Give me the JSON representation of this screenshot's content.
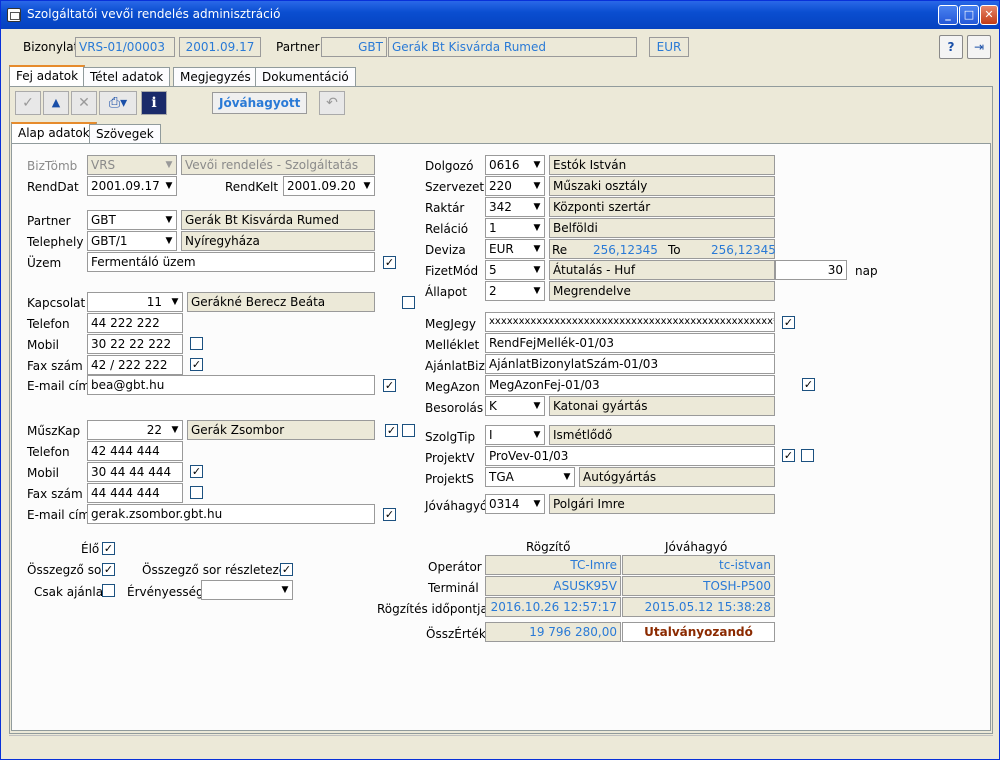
{
  "window": {
    "title": "Szolgáltatói vevői rendelés adminisztráció"
  },
  "header": {
    "bizonylat_label": "Bizonylat",
    "doc_no": "VRS-01/00003",
    "date": "2001.09.17",
    "partner_label": "Partner",
    "partner_code": "GBT",
    "partner_name": "Gerák Bt Kisvárda Rumed",
    "currency": "EUR"
  },
  "tabs": [
    "Fej adatok",
    "Tétel adatok",
    "Megjegyzés",
    "Dokumentáció"
  ],
  "toolbar": {
    "approved_label": "Jóváhagyott"
  },
  "subtabs": [
    "Alap adatok",
    "Szövegek"
  ],
  "left": {
    "biztomb_label": "BizTömb",
    "biztomb_value": "VRS",
    "biztomb_desc": "Vevői rendelés - Szolgáltatás",
    "renddat_label": "RendDat",
    "renddat_value": "2001.09.17",
    "rendkelt_label": "RendKelt",
    "rendkelt_value": "2001.09.20",
    "partner_label": "Partner",
    "partner_code": "GBT",
    "partner_name": "Gerák Bt Kisvárda Rumed",
    "telephely_label": "Telephely",
    "telephely_code": "GBT/1",
    "telephely_name": "Nyíregyháza",
    "uzem_label": "Üzem",
    "uzem_value": "Fermentáló üzem",
    "kapcsolat_label": "Kapcsolat",
    "kapcsolat_no": "11",
    "kapcsolat_name": "Gerákné Berecz Beáta",
    "telefon_label": "Telefon",
    "telefon1": "44 222 222",
    "mobil_label": "Mobil",
    "mobil1": "30 22 22 222",
    "fax_label": "Fax szám",
    "fax1": "42 / 222 222",
    "email_label": "E-mail cím",
    "email1": "bea@gbt.hu",
    "muszkap_label": "MűszKap",
    "muszkap_no": "22",
    "muszkap_name": "Gerák Zsombor",
    "telefon2": "42 444 444",
    "mobil2": "30 44 44 444",
    "fax2": "44 444 444",
    "email2": "gerak.zsombor.gbt.hu",
    "elo_label": "Élő",
    "osszegzo_label": "Összegző sor",
    "osszegzo_resz_label": "Összegző sor részletezés",
    "csak_label": "Csak ajánlat",
    "ervenyesseg_label": "Érvényesség"
  },
  "right": {
    "dolgozo_label": "Dolgozó",
    "dolgozo_code": "0616",
    "dolgozo_name": "Estók István",
    "szervezet_label": "Szervezet",
    "szervezet_code": "220",
    "szervezet_name": "Műszaki osztály",
    "raktar_label": "Raktár",
    "raktar_code": "342",
    "raktar_name": "Központi szertár",
    "relacio_label": "Reláció",
    "relacio_code": "1",
    "relacio_name": "Belföldi",
    "deviza_label": "Deviza",
    "deviza_code": "EUR",
    "re_label": "Re",
    "re_value": "256,12345",
    "to_label": "To",
    "to_value": "256,12345",
    "fizetmod_label": "FizetMód",
    "fizetmod_code": "5",
    "fizetmod_name": "Átutalás - Huf",
    "fizetmod_days": "30",
    "nap_label": "nap",
    "allapot_label": "Állapot",
    "allapot_code": "2",
    "allapot_name": "Megrendelve",
    "megjegy_label": "MegJegy",
    "megjegy_value": "xxxxxxxxxxxxxxxxxxxxxxxxxxxxxxxxxxxxxxxxxxxxxxxx*",
    "melleklet_label": "Melléklet",
    "melleklet_value": "RendFejMellék-01/03",
    "ajanlatbiz_label": "AjánlatBiz",
    "ajanlatbiz_value": "AjánlatBizonylatSzám-01/03",
    "megazon_label": "MegAzon",
    "megazon_value": "MegAzonFej-01/03",
    "besorolas_label": "Besorolás",
    "besorolas_code": "K",
    "besorolas_name": "Katonai gyártás",
    "szolgtip_label": "SzolgTip",
    "szolgtip_code": "I",
    "szolgtip_name": "Ismétlődő",
    "projektv_label": "ProjektV",
    "projektv_value": "ProVev-01/03",
    "projekts_label": "ProjektS",
    "projekts_code": "TGA",
    "projekts_name": "Autógyártás",
    "jovahagyo_label": "Jóváhagyó",
    "jovahagyo_code": "0314",
    "jovahagyo_name": "Polgári Imre",
    "rogzito_hdr": "Rögzítő",
    "jovahagyo_hdr": "Jóváhagyó",
    "operator_label": "Operátor",
    "operator_r": "TC-Imre",
    "operator_j": "tc-istvan",
    "terminal_label": "Terminál",
    "terminal_r": "ASUSK95V",
    "terminal_j": "TOSH-P500",
    "rogzites_label": "Rögzítés időpontja",
    "rogzites_r": "2016.10.26 12:57:17",
    "rogzites_j": "2015.05.12 15:38:28",
    "osszertek_label": "ÖsszÉrték",
    "osszertek_value": "19 796 280,00",
    "osszertek_status": "Utalványozandó"
  }
}
